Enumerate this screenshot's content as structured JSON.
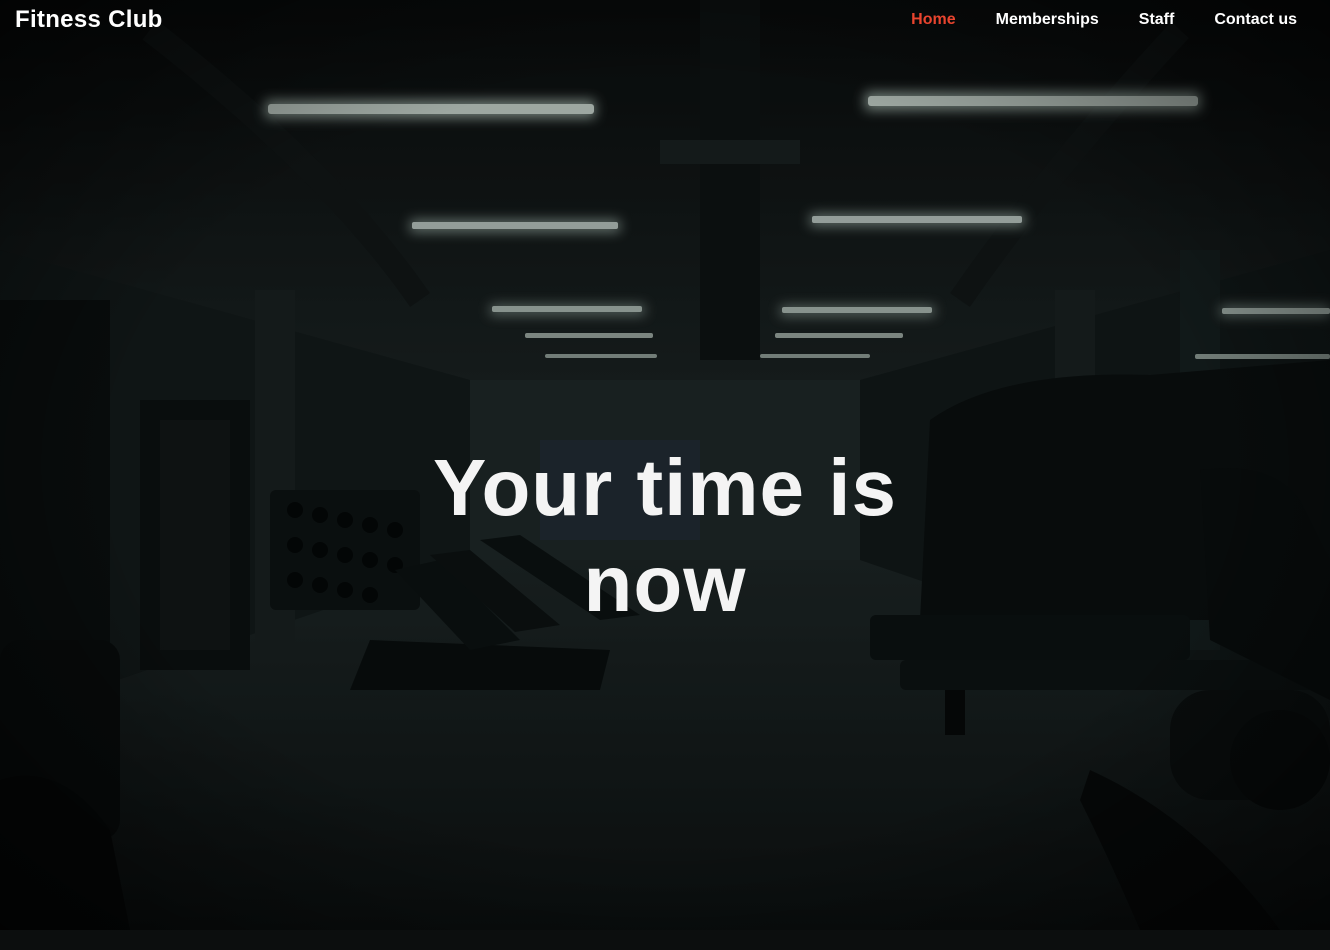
{
  "brand": {
    "name": "Fitness Club"
  },
  "nav": {
    "items": [
      {
        "label": "Home",
        "active": true
      },
      {
        "label": "Memberships",
        "active": false
      },
      {
        "label": "Staff",
        "active": false
      },
      {
        "label": "Contact us",
        "active": false
      }
    ]
  },
  "hero": {
    "headline": "Your time is now",
    "background": "dark gym interior photo"
  },
  "colors": {
    "accent": "#e8442e",
    "text": "#ffffff",
    "background": "#0b0f0f"
  }
}
